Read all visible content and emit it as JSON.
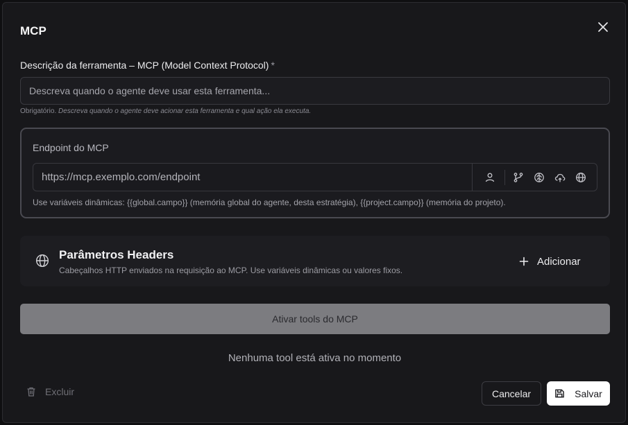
{
  "dialog": {
    "title": "MCP"
  },
  "description": {
    "label": "Descrição da ferramenta – MCP (Model Context Protocol)",
    "required_mark": "*",
    "placeholder": "Descreva quando o agente deve usar esta ferramenta...",
    "value": "",
    "hint_prefix": "Obrigatório.",
    "hint_text": "Descreva quando o agente deve acionar esta ferramenta e qual ação ela executa."
  },
  "endpoint": {
    "title": "Endpoint do MCP",
    "placeholder": "https://mcp.exemplo.com/endpoint",
    "value": "",
    "hint": "Use variáveis dinâmicas: {{global.campo}} (memória global do agente, desta estratégia), {{project.campo}} (memória do projeto).",
    "icons": [
      "user-icon",
      "git-branch-icon",
      "brain-icon",
      "cloud-icon",
      "globe-icon"
    ]
  },
  "headers": {
    "title": "Parâmetros Headers",
    "subtitle": "Cabeçalhos HTTP enviados na requisição ao MCP. Use variáveis dinâmicas ou valores fixos.",
    "add_label": "Adicionar"
  },
  "tools": {
    "activate_label": "Ativar tools do MCP",
    "empty_text": "Nenhuma tool está ativa no momento"
  },
  "footer": {
    "delete_label": "Excluir",
    "cancel_label": "Cancelar",
    "save_label": "Salvar"
  },
  "colors": {
    "background": "#18181b",
    "activate_button": "#7c7c80",
    "save_button": "#ffffff"
  }
}
